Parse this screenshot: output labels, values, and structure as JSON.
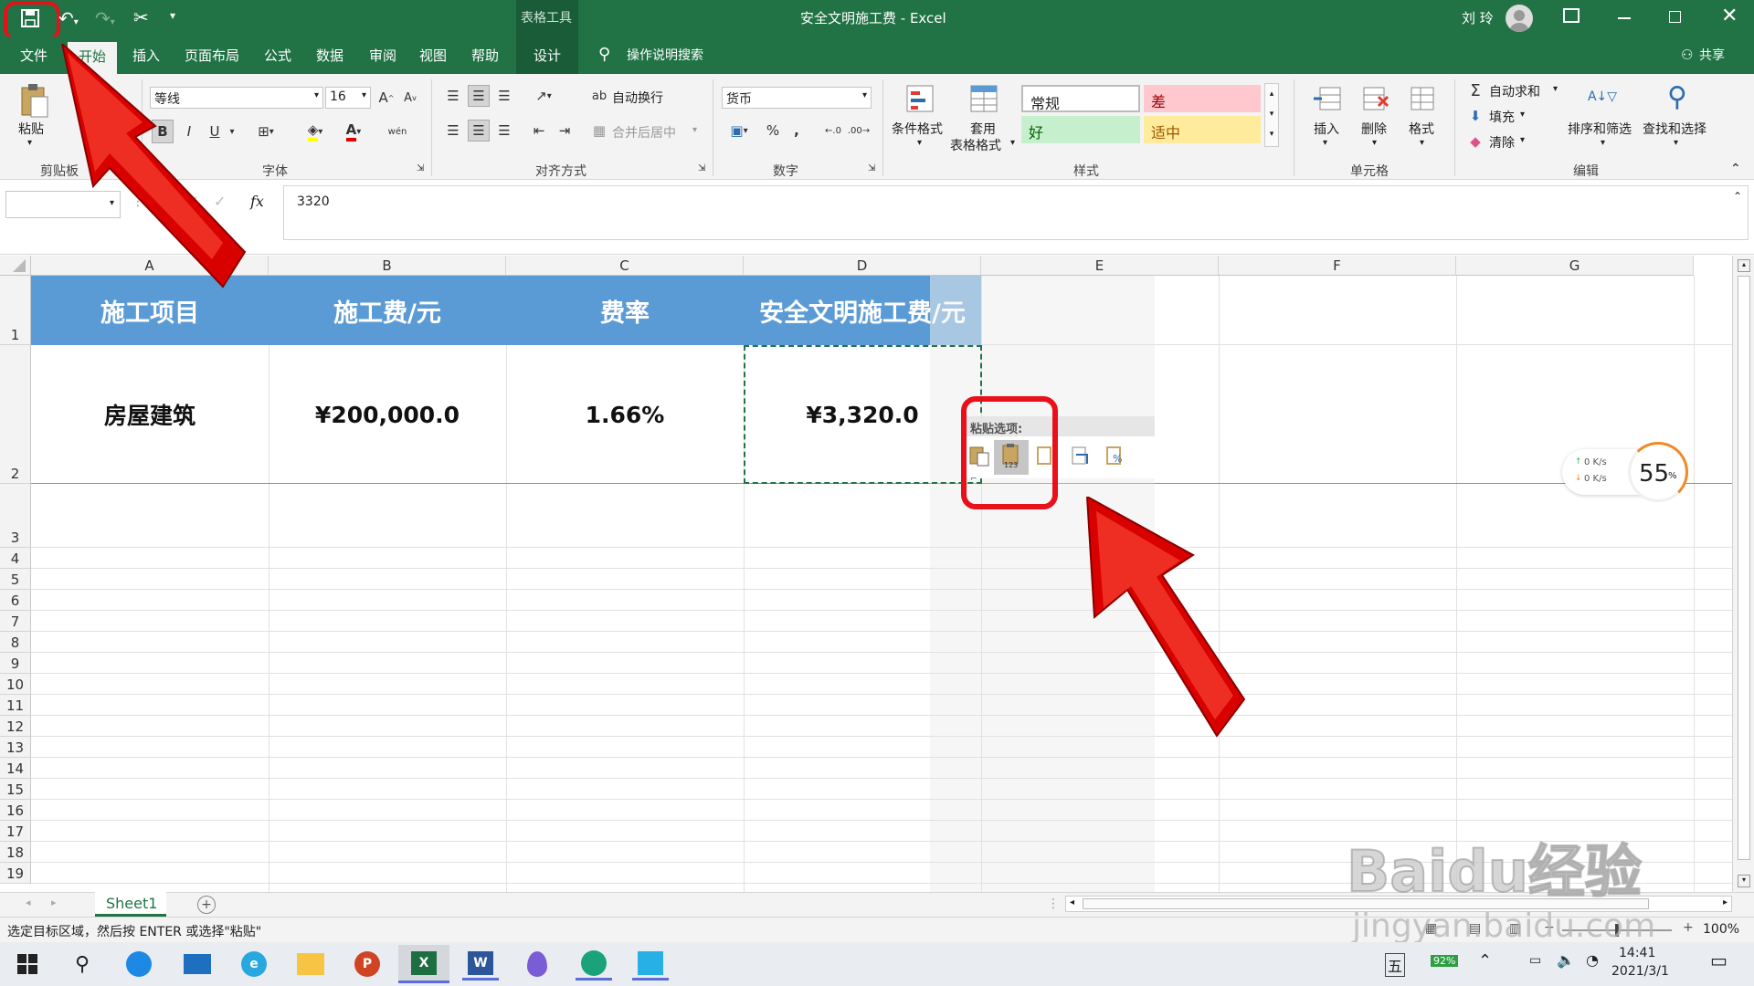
{
  "window": {
    "title": "安全文明施工费 - Excel",
    "context_tab_group": "表格工具",
    "user": "刘 玲"
  },
  "tabs": [
    "文件",
    "开始",
    "插入",
    "页面布局",
    "公式",
    "数据",
    "审阅",
    "视图",
    "帮助",
    "设计"
  ],
  "active_tab": "开始",
  "tell_me": "操作说明搜索",
  "share": "共享",
  "ribbon": {
    "clipboard": {
      "paste": "粘贴",
      "label": "剪贴板"
    },
    "font": {
      "name": "等线",
      "size": "16",
      "label": "字体",
      "bold": "B",
      "italic": "I",
      "underline": "U",
      "wen": "wén"
    },
    "alignment": {
      "wrap": "自动换行",
      "merge": "合并后居中",
      "label": "对齐方式"
    },
    "number": {
      "format": "货币",
      "percent": "%",
      "comma": ",",
      "label": "数字"
    },
    "styles": {
      "cond": "条件格式",
      "table1": "套用",
      "table2": "表格格式",
      "normal": "常规",
      "bad": "差",
      "good": "好",
      "neutral": "适中",
      "label": "样式"
    },
    "cells": {
      "insert": "插入",
      "delete": "删除",
      "format": "格式",
      "label": "单元格"
    },
    "editing": {
      "autosum": "自动求和",
      "fill": "填充",
      "clear": "清除",
      "sort": "排序和筛选",
      "find": "查找和选择",
      "label": "编辑"
    }
  },
  "formula_bar": {
    "name_box": "",
    "fx": "fx",
    "value": "3320"
  },
  "columns": [
    "A",
    "B",
    "C",
    "D",
    "E",
    "F",
    "G"
  ],
  "rows": [
    "1",
    "2",
    "3",
    "4",
    "5",
    "6",
    "7",
    "8",
    "9",
    "10",
    "11",
    "12",
    "13",
    "14",
    "15",
    "16",
    "17",
    "18",
    "19"
  ],
  "table": {
    "headers": [
      "施工项目",
      "施工费/元",
      "费率",
      "安全文明施工费/元"
    ],
    "row": [
      "房屋建筑",
      "¥200,000.0",
      "1.66%",
      "¥3,320.0"
    ]
  },
  "paste_options": {
    "title": "粘贴选项:",
    "num_badge": "123"
  },
  "net_widget": {
    "up": "0  K/s",
    "down": "0  K/s",
    "percent": "55",
    "unit": "%"
  },
  "sheet_tab": "Sheet1",
  "status": {
    "message": "选定目标区域，然后按 ENTER 或选择\"粘贴\"",
    "zoom": "100%"
  },
  "taskbar": {
    "ime": "五",
    "battery": "92%",
    "time": "14:41",
    "date": "2021/3/1"
  },
  "watermark": {
    "logo": "Baidu经验",
    "url": "jingyan.baidu.com"
  },
  "colors": {
    "excel_green": "#217346",
    "table_header": "#5b9bd5",
    "annotation_red": "#e8101a",
    "arrow_red": "#d90000"
  }
}
